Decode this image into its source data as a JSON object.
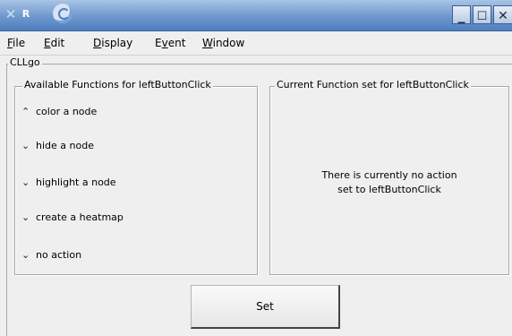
{
  "titlebar": {
    "app_icon": "x-icon",
    "r_label": "R",
    "swirl_icon": "swirl-icon",
    "minimize": "_",
    "maximize": "☐",
    "close": "✕"
  },
  "menubar": {
    "items": [
      {
        "label": "File",
        "mnemonic": "F",
        "rest": "ile"
      },
      {
        "label": "Edit",
        "mnemonic": "E",
        "rest": "dit"
      },
      {
        "label": "Display",
        "mnemonic": "D",
        "rest": "isplay"
      },
      {
        "label": "Event",
        "pre": "E",
        "mnemonic": "v",
        "rest": "ent"
      },
      {
        "label": "Window",
        "mnemonic": "W",
        "rest": "indow"
      }
    ]
  },
  "main": {
    "frame_label": "CLLgo",
    "left_group_label": "Available Functions for leftButtonClick",
    "right_group_label": "Current Function set for leftButtonClick",
    "options": [
      {
        "label": "color a node",
        "selected": true
      },
      {
        "label": "hide a node",
        "selected": false
      },
      {
        "label": "highlight a node",
        "selected": false
      },
      {
        "label": "create a heatmap",
        "selected": false
      },
      {
        "label": "no action",
        "selected": false
      }
    ],
    "message_line1": "There is currently no action",
    "message_line2": "set to leftButtonClick",
    "set_button": "Set"
  }
}
